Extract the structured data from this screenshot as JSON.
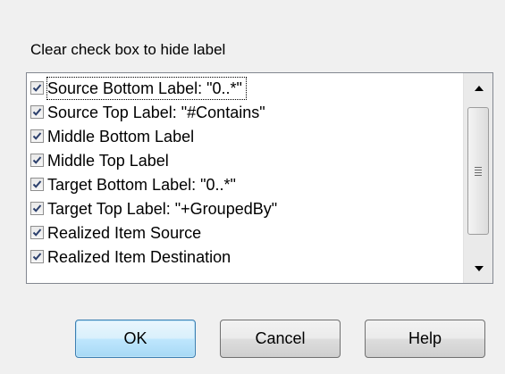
{
  "dialog": {
    "instruction": "Clear check box to hide label"
  },
  "label_list": {
    "items": [
      {
        "label": "Source Bottom Label:  \"0..*\"",
        "checked": true
      },
      {
        "label": "Source Top Label:  \"#Contains\"",
        "checked": true
      },
      {
        "label": "Middle Bottom Label",
        "checked": true
      },
      {
        "label": "Middle Top Label",
        "checked": true
      },
      {
        "label": "Target Bottom Label:  \"0..*\"",
        "checked": true
      },
      {
        "label": "Target Top Label:  \"+GroupedBy\"",
        "checked": true
      },
      {
        "label": "Realized Item Source",
        "checked": true
      },
      {
        "label": "Realized Item Destination",
        "checked": true
      }
    ],
    "scroll_icons": {
      "up": "scroll-up-arrow-icon",
      "down": "scroll-down-arrow-icon",
      "thumb": "scroll-thumb-grip-icon"
    }
  },
  "buttons": {
    "ok_label": "OK",
    "cancel_label": "Cancel",
    "help_label": "Help"
  },
  "colors": {
    "dialog_background": "#f0f0f0",
    "default_button_border": "#3c7fb1",
    "checkmark": "#2b3f6c"
  }
}
